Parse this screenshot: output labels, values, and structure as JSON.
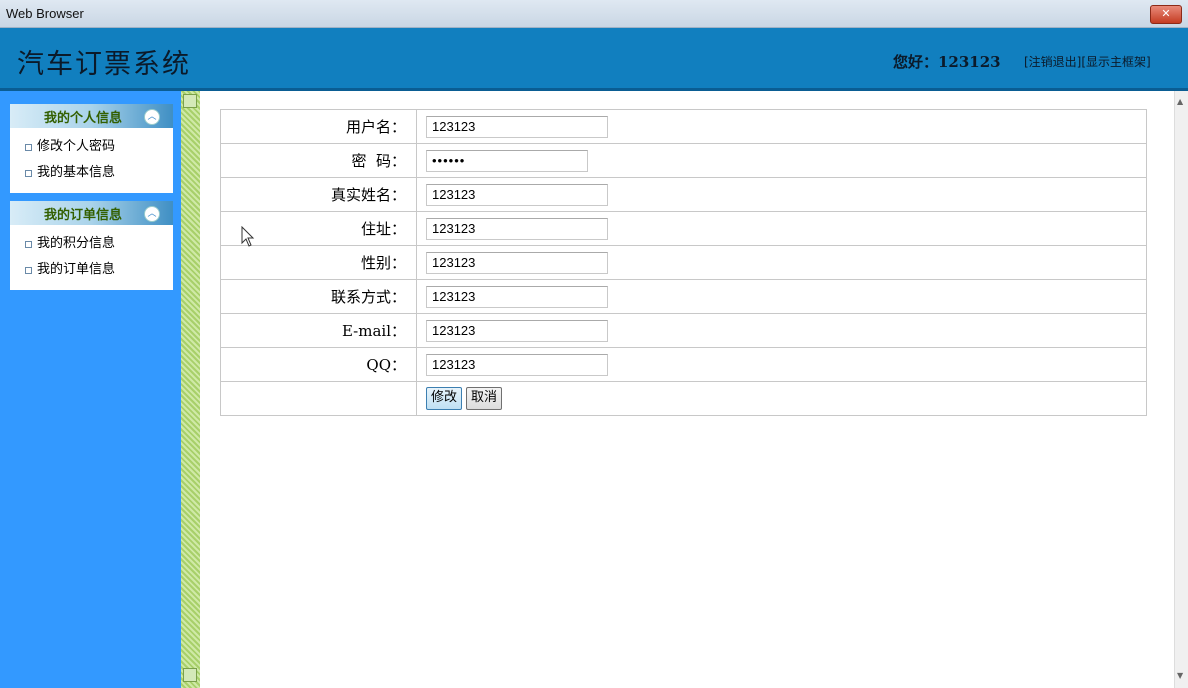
{
  "window": {
    "title": "Web Browser",
    "close_icon": "close-icon"
  },
  "header": {
    "logo": "汽车订票系统",
    "greeting": "您好：123123",
    "logout_link": "[注销退出]",
    "show_frame_link": "[显示主框架]"
  },
  "sidebar": {
    "sections": [
      {
        "title": "我的个人信息",
        "items": [
          "修改个人密码",
          "我的基本信息"
        ]
      },
      {
        "title": "我的订单信息",
        "items": [
          "我的积分信息",
          "我的订单信息"
        ]
      }
    ]
  },
  "form": {
    "rows": [
      {
        "label": "用户名：",
        "value": "123123"
      },
      {
        "label": "密  码：",
        "value": "••••••"
      },
      {
        "label": "真实姓名：",
        "value": "123123"
      },
      {
        "label": "住址：",
        "value": "123123"
      },
      {
        "label": "性别：",
        "value": "123123"
      },
      {
        "label": "联系方式：",
        "value": "123123"
      },
      {
        "label": "E-mail：",
        "value": "123123"
      },
      {
        "label": "QQ：",
        "value": "123123"
      }
    ],
    "submit_label": "修改",
    "cancel_label": "取消"
  },
  "colors": {
    "header_bg": "#117fbf",
    "sidebar_bg": "#3399ff",
    "splitter": "#a8d06a"
  }
}
